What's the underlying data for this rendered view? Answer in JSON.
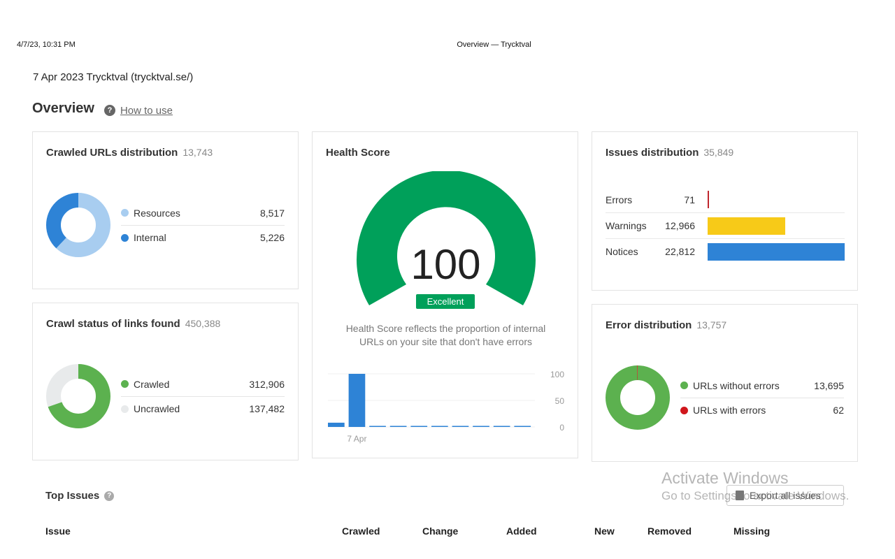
{
  "print_header": {
    "date": "4/7/23, 10:31 PM",
    "title": "Overview — Trycktval"
  },
  "site_line": "7 Apr 2023 Trycktval (trycktval.se/)",
  "overview": {
    "title": "Overview",
    "help": "?",
    "how_to": "How to use"
  },
  "crawled_urls": {
    "title": "Crawled URLs distribution",
    "count": "13,743",
    "items": [
      {
        "label": "Resources",
        "value": "8,517",
        "color": "#a8cdf0",
        "amount": 8517
      },
      {
        "label": "Internal",
        "value": "5,226",
        "color": "#2e83d6",
        "amount": 5226
      }
    ]
  },
  "crawl_status": {
    "title": "Crawl status of links found",
    "count": "450,388",
    "items": [
      {
        "label": "Crawled",
        "value": "312,906",
        "color": "#5cb14f",
        "amount": 312906
      },
      {
        "label": "Uncrawled",
        "value": "137,482",
        "color": "#e8eaeb",
        "amount": 137482
      }
    ]
  },
  "health": {
    "title": "Health Score",
    "score": "100",
    "badge": "Excellent",
    "description_line1": "Health Score reflects the proportion of internal",
    "description_line2": "URLs on your site that don't have errors",
    "color": "#00a05a",
    "chart": {
      "bars": [
        8,
        100,
        1,
        1,
        1,
        1,
        1,
        1,
        1,
        1
      ],
      "x_label": "7 Apr",
      "y_ticks": [
        "100",
        "50",
        "0"
      ],
      "ymax": 100,
      "bar_color": "#2e83d6"
    }
  },
  "issues_distribution": {
    "title": "Issues distribution",
    "count": "35,849",
    "rows": [
      {
        "label": "Errors",
        "value": "71",
        "color": "#c0262d",
        "amount": 71
      },
      {
        "label": "Warnings",
        "value": "12,966",
        "color": "#f7ca18",
        "amount": 12966
      },
      {
        "label": "Notices",
        "value": "22,812",
        "color": "#2e83d6",
        "amount": 22812
      }
    ]
  },
  "error_distribution": {
    "title": "Error distribution",
    "count": "13,757",
    "items": [
      {
        "label": "URLs without errors",
        "value": "13,695",
        "color": "#5cb14f",
        "amount": 13695
      },
      {
        "label": "URLs with errors",
        "value": "62",
        "color": "#d0161c",
        "amount": 62
      }
    ]
  },
  "top_issues": {
    "title": "Top Issues",
    "help": "?",
    "export_label": "Export all issues",
    "columns": [
      "Issue",
      "Crawled",
      "Change",
      "Added",
      "New",
      "Removed",
      "Missing"
    ]
  },
  "watermark": {
    "line1": "Activate Windows",
    "line2": "Go to Settings to activate Windows."
  }
}
